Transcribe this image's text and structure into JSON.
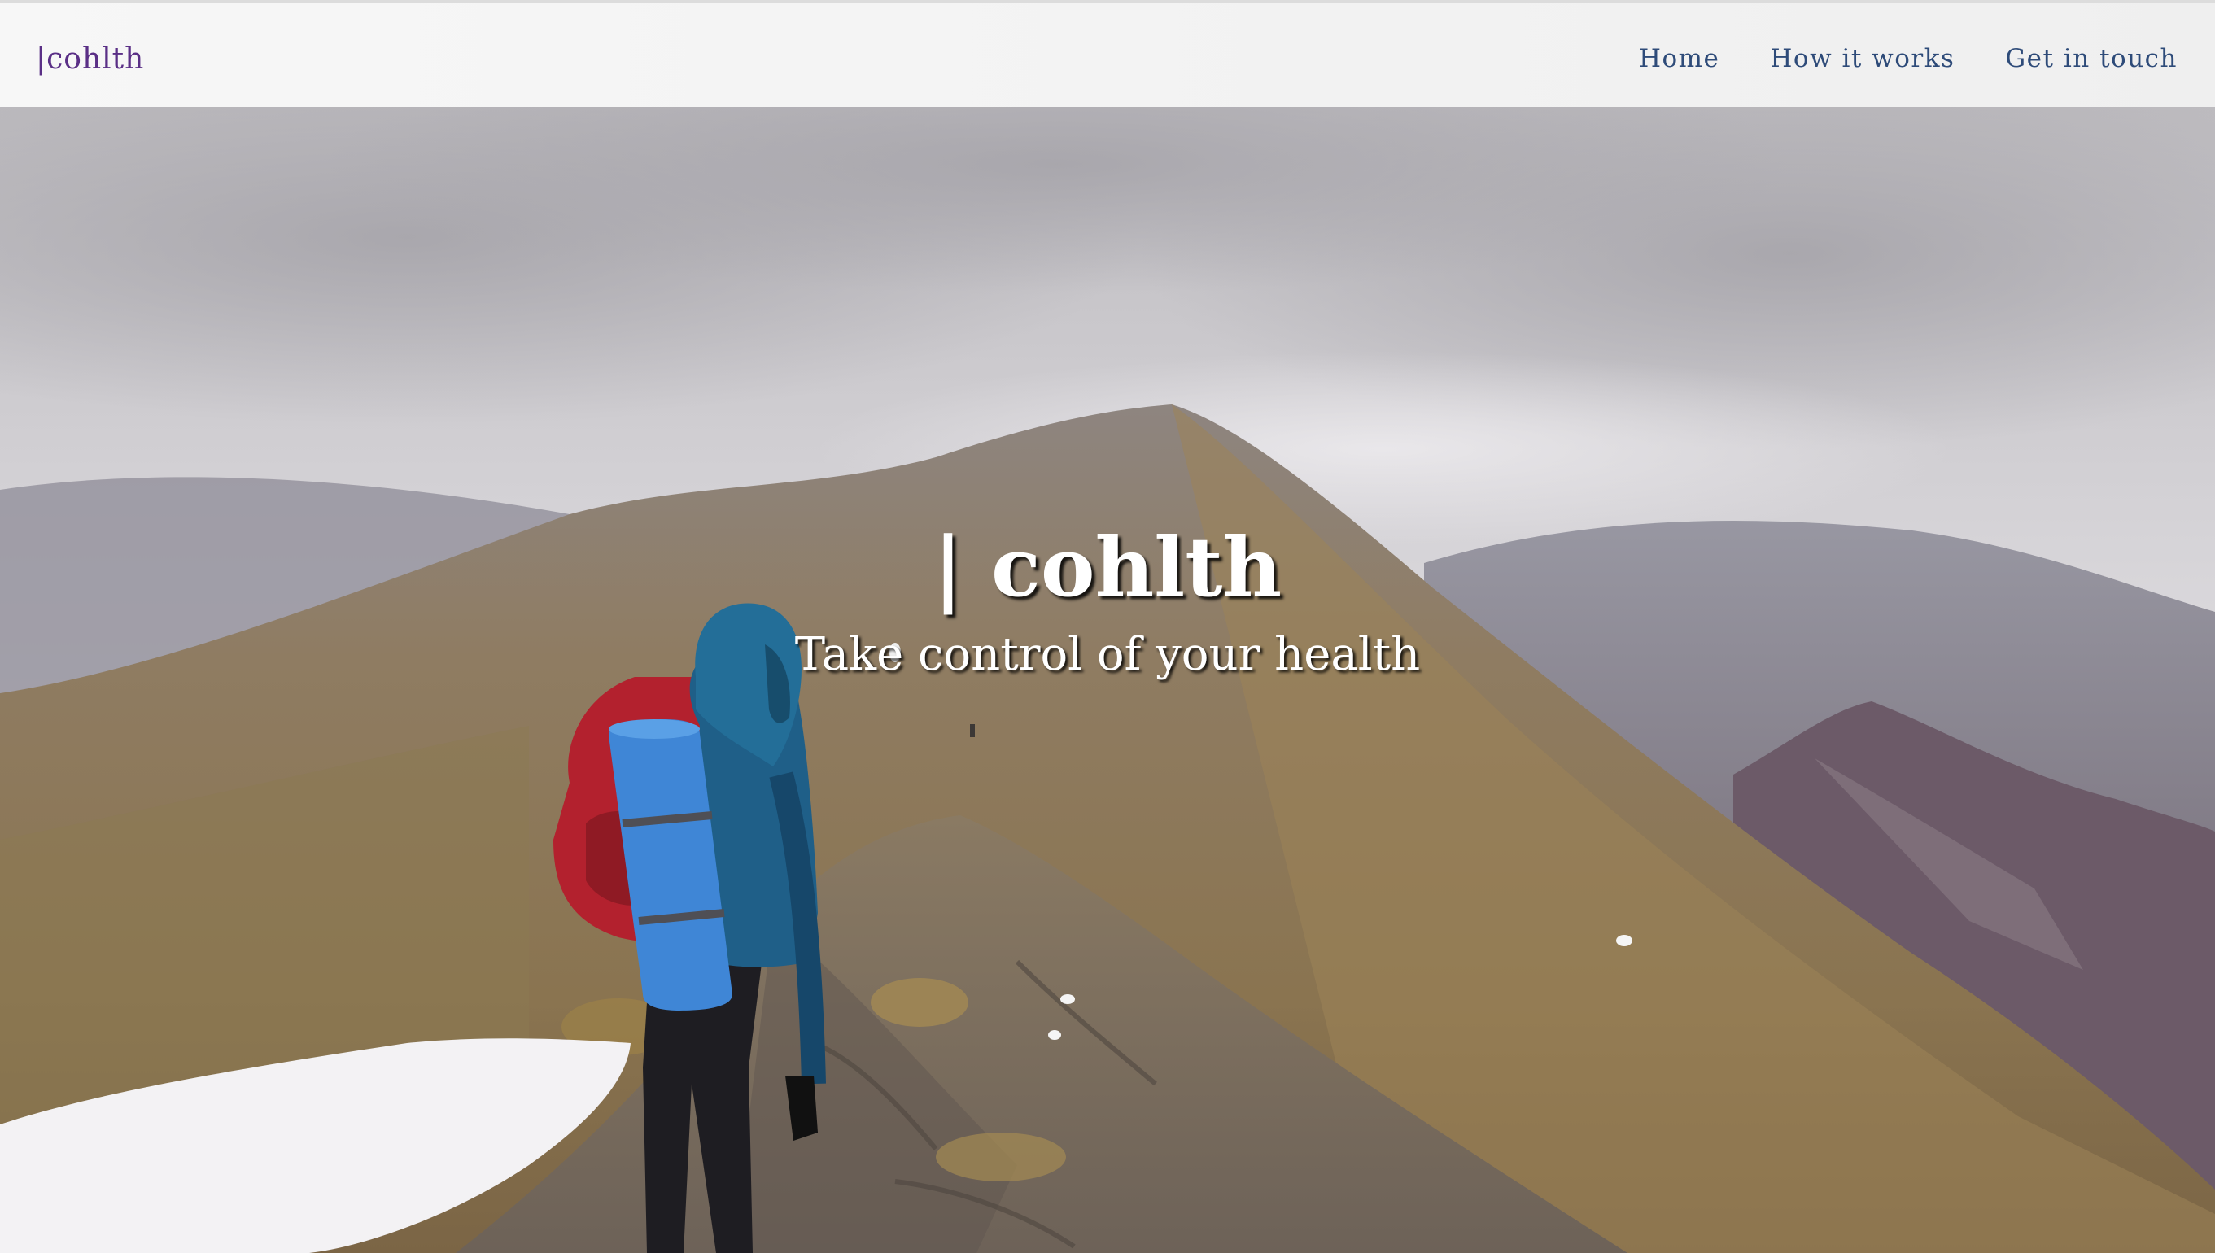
{
  "header": {
    "brand": "|cohlth",
    "nav": [
      {
        "label": "Home"
      },
      {
        "label": "How it works"
      },
      {
        "label": "Get in touch"
      }
    ]
  },
  "hero": {
    "title": "| cohlth",
    "subtitle": "Take control of your health",
    "image_description_icon": "hiker-on-mountain-ridge-image"
  },
  "colors": {
    "brand": "#5a2f86",
    "nav_link": "#2e4b79",
    "nav_bg": "#f4f4f4",
    "hero_text": "#ffffff"
  }
}
